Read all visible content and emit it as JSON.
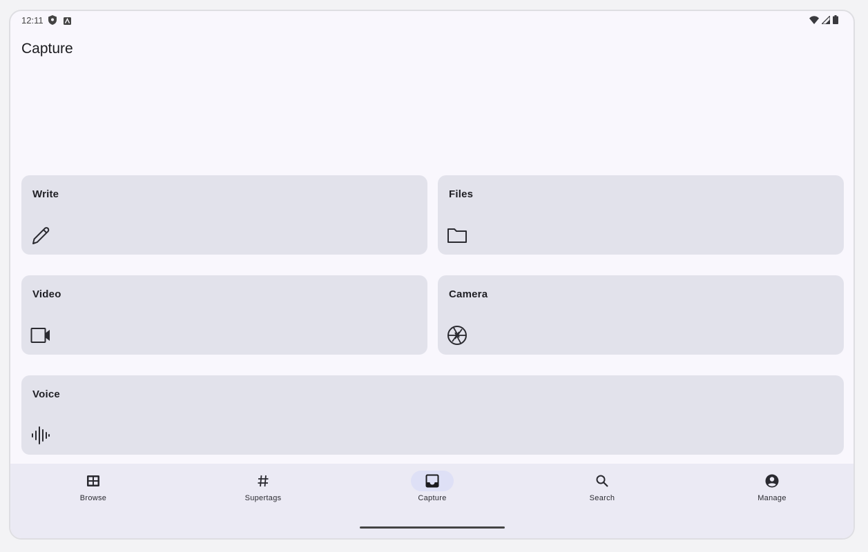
{
  "status_bar": {
    "time": "12:11",
    "left_icons": [
      "shield-icon",
      "app-notification-icon"
    ],
    "right_icons": [
      "wifi-icon",
      "cell-signal-icon",
      "battery-icon"
    ]
  },
  "header": {
    "title": "Capture"
  },
  "cards": [
    {
      "label": "Write",
      "icon": "pencil-icon"
    },
    {
      "label": "Files",
      "icon": "folder-icon"
    },
    {
      "label": "Video",
      "icon": "videocam-icon"
    },
    {
      "label": "Camera",
      "icon": "camera-aperture-icon"
    },
    {
      "label": "Voice",
      "icon": "waveform-icon"
    }
  ],
  "nav": {
    "active": "Capture",
    "items": [
      {
        "label": "Browse",
        "icon": "grid-icon"
      },
      {
        "label": "Supertags",
        "icon": "hashtag-icon"
      },
      {
        "label": "Capture",
        "icon": "inbox-icon"
      },
      {
        "label": "Search",
        "icon": "search-icon"
      },
      {
        "label": "Manage",
        "icon": "account-circle-icon"
      }
    ]
  },
  "colors": {
    "background": "#f9f7fd",
    "card": "#e2e2eb",
    "nav_bar": "#ebeaf4",
    "nav_active_pill": "#dee0f6",
    "text": "#1f1f24"
  }
}
